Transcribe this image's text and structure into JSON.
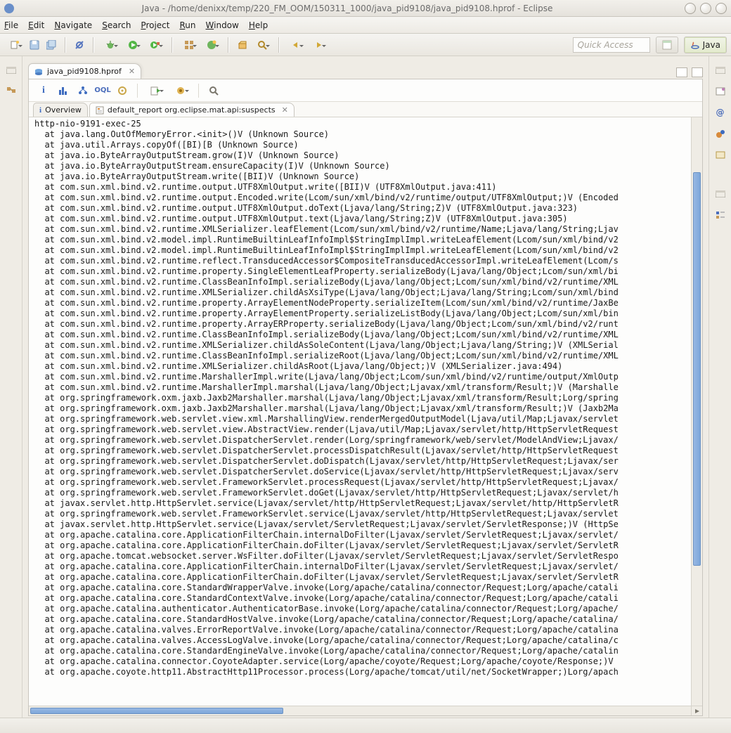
{
  "window": {
    "title": "Java - /home/denixx/temp/220_FM_OOM/150311_1000/java_pid9108/java_pid9108.hprof - Eclipse"
  },
  "menu": [
    "File",
    "Edit",
    "Navigate",
    "Search",
    "Project",
    "Run",
    "Window",
    "Help"
  ],
  "quick_access_placeholder": "Quick Access",
  "perspective": {
    "open_label": "",
    "java_label": "Java"
  },
  "editor": {
    "tab_label": "java_pid9108.hprof",
    "subtabs": {
      "overview": "Overview",
      "report": "default_report  org.eclipse.mat.api:suspects"
    }
  },
  "trace_header": "http-nio-9191-exec-25",
  "trace_lines": [
    "java.lang.OutOfMemoryError.<init>()V (Unknown Source)",
    "java.util.Arrays.copyOf([BI)[B (Unknown Source)",
    "java.io.ByteArrayOutputStream.grow(I)V (Unknown Source)",
    "java.io.ByteArrayOutputStream.ensureCapacity(I)V (Unknown Source)",
    "java.io.ByteArrayOutputStream.write([BII)V (Unknown Source)",
    "com.sun.xml.bind.v2.runtime.output.UTF8XmlOutput.write([BII)V (UTF8XmlOutput.java:411)",
    "com.sun.xml.bind.v2.runtime.output.Encoded.write(Lcom/sun/xml/bind/v2/runtime/output/UTF8XmlOutput;)V (Encoded",
    "com.sun.xml.bind.v2.runtime.output.UTF8XmlOutput.doText(Ljava/lang/String;Z)V (UTF8XmlOutput.java:323)",
    "com.sun.xml.bind.v2.runtime.output.UTF8XmlOutput.text(Ljava/lang/String;Z)V (UTF8XmlOutput.java:305)",
    "com.sun.xml.bind.v2.runtime.XMLSerializer.leafElement(Lcom/sun/xml/bind/v2/runtime/Name;Ljava/lang/String;Ljav",
    "com.sun.xml.bind.v2.model.impl.RuntimeBuiltinLeafInfoImpl$StringImplImpl.writeLeafElement(Lcom/sun/xml/bind/v2",
    "com.sun.xml.bind.v2.model.impl.RuntimeBuiltinLeafInfoImpl$StringImplImpl.writeLeafElement(Lcom/sun/xml/bind/v2",
    "com.sun.xml.bind.v2.runtime.reflect.TransducedAccessor$CompositeTransducedAccessorImpl.writeLeafElement(Lcom/s",
    "com.sun.xml.bind.v2.runtime.property.SingleElementLeafProperty.serializeBody(Ljava/lang/Object;Lcom/sun/xml/bi",
    "com.sun.xml.bind.v2.runtime.ClassBeanInfoImpl.serializeBody(Ljava/lang/Object;Lcom/sun/xml/bind/v2/runtime/XML",
    "com.sun.xml.bind.v2.runtime.XMLSerializer.childAsXsiType(Ljava/lang/Object;Ljava/lang/String;Lcom/sun/xml/bind",
    "com.sun.xml.bind.v2.runtime.property.ArrayElementNodeProperty.serializeItem(Lcom/sun/xml/bind/v2/runtime/JaxBe",
    "com.sun.xml.bind.v2.runtime.property.ArrayElementProperty.serializeListBody(Ljava/lang/Object;Lcom/sun/xml/bin",
    "com.sun.xml.bind.v2.runtime.property.ArrayERProperty.serializeBody(Ljava/lang/Object;Lcom/sun/xml/bind/v2/runt",
    "com.sun.xml.bind.v2.runtime.ClassBeanInfoImpl.serializeBody(Ljava/lang/Object;Lcom/sun/xml/bind/v2/runtime/XML",
    "com.sun.xml.bind.v2.runtime.XMLSerializer.childAsSoleContent(Ljava/lang/Object;Ljava/lang/String;)V (XMLSerial",
    "com.sun.xml.bind.v2.runtime.ClassBeanInfoImpl.serializeRoot(Ljava/lang/Object;Lcom/sun/xml/bind/v2/runtime/XML",
    "com.sun.xml.bind.v2.runtime.XMLSerializer.childAsRoot(Ljava/lang/Object;)V (XMLSerializer.java:494)",
    "com.sun.xml.bind.v2.runtime.MarshallerImpl.write(Ljava/lang/Object;Lcom/sun/xml/bind/v2/runtime/output/XmlOutp",
    "com.sun.xml.bind.v2.runtime.MarshallerImpl.marshal(Ljava/lang/Object;Ljavax/xml/transform/Result;)V (Marshalle",
    "org.springframework.oxm.jaxb.Jaxb2Marshaller.marshal(Ljava/lang/Object;Ljavax/xml/transform/Result;Lorg/spring",
    "org.springframework.oxm.jaxb.Jaxb2Marshaller.marshal(Ljava/lang/Object;Ljavax/xml/transform/Result;)V (Jaxb2Ma",
    "org.springframework.web.servlet.view.xml.MarshallingView.renderMergedOutputModel(Ljava/util/Map;Ljavax/servlet",
    "org.springframework.web.servlet.view.AbstractView.render(Ljava/util/Map;Ljavax/servlet/http/HttpServletRequest",
    "org.springframework.web.servlet.DispatcherServlet.render(Lorg/springframework/web/servlet/ModelAndView;Ljavax/",
    "org.springframework.web.servlet.DispatcherServlet.processDispatchResult(Ljavax/servlet/http/HttpServletRequest",
    "org.springframework.web.servlet.DispatcherServlet.doDispatch(Ljavax/servlet/http/HttpServletRequest;Ljavax/ser",
    "org.springframework.web.servlet.DispatcherServlet.doService(Ljavax/servlet/http/HttpServletRequest;Ljavax/serv",
    "org.springframework.web.servlet.FrameworkServlet.processRequest(Ljavax/servlet/http/HttpServletRequest;Ljavax/",
    "org.springframework.web.servlet.FrameworkServlet.doGet(Ljavax/servlet/http/HttpServletRequest;Ljavax/servlet/h",
    "javax.servlet.http.HttpServlet.service(Ljavax/servlet/http/HttpServletRequest;Ljavax/servlet/http/HttpServletR",
    "org.springframework.web.servlet.FrameworkServlet.service(Ljavax/servlet/http/HttpServletRequest;Ljavax/servlet",
    "javax.servlet.http.HttpServlet.service(Ljavax/servlet/ServletRequest;Ljavax/servlet/ServletResponse;)V (HttpSe",
    "org.apache.catalina.core.ApplicationFilterChain.internalDoFilter(Ljavax/servlet/ServletRequest;Ljavax/servlet/",
    "org.apache.catalina.core.ApplicationFilterChain.doFilter(Ljavax/servlet/ServletRequest;Ljavax/servlet/ServletR",
    "org.apache.tomcat.websocket.server.WsFilter.doFilter(Ljavax/servlet/ServletRequest;Ljavax/servlet/ServletRespo",
    "org.apache.catalina.core.ApplicationFilterChain.internalDoFilter(Ljavax/servlet/ServletRequest;Ljavax/servlet/",
    "org.apache.catalina.core.ApplicationFilterChain.doFilter(Ljavax/servlet/ServletRequest;Ljavax/servlet/ServletR",
    "org.apache.catalina.core.StandardWrapperValve.invoke(Lorg/apache/catalina/connector/Request;Lorg/apache/catali",
    "org.apache.catalina.core.StandardContextValve.invoke(Lorg/apache/catalina/connector/Request;Lorg/apache/catali",
    "org.apache.catalina.authenticator.AuthenticatorBase.invoke(Lorg/apache/catalina/connector/Request;Lorg/apache/",
    "org.apache.catalina.core.StandardHostValve.invoke(Lorg/apache/catalina/connector/Request;Lorg/apache/catalina/",
    "org.apache.catalina.valves.ErrorReportValve.invoke(Lorg/apache/catalina/connector/Request;Lorg/apache/catalina",
    "org.apache.catalina.valves.AccessLogValve.invoke(Lorg/apache/catalina/connector/Request;Lorg/apache/catalina/c",
    "org.apache.catalina.core.StandardEngineValve.invoke(Lorg/apache/catalina/connector/Request;Lorg/apache/catalin",
    "org.apache.catalina.connector.CoyoteAdapter.service(Lorg/apache/coyote/Request;Lorg/apache/coyote/Response;)V",
    "org.apache.coyote.http11.AbstractHttp11Processor.process(Lorg/apache/tomcat/util/net/SocketWrapper;)Lorg/apach"
  ]
}
